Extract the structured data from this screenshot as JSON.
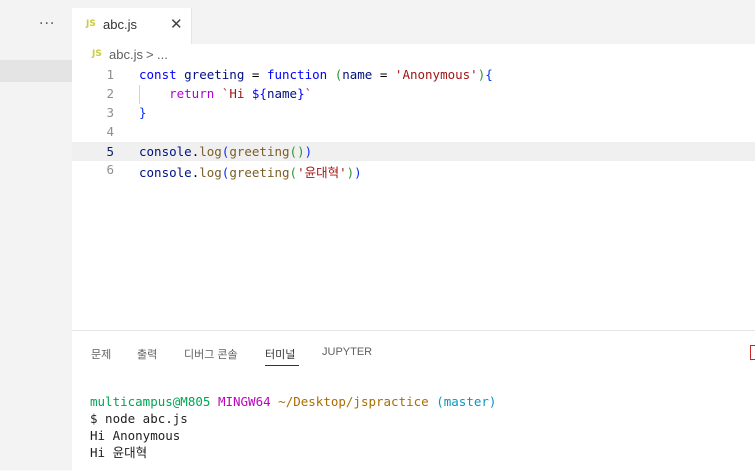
{
  "tab_bar": {
    "more_label": "···",
    "active_tab": {
      "icon": "JS",
      "title": "abc.js",
      "close": "✕"
    }
  },
  "breadcrumb": {
    "icon": "JS",
    "file": "abc.js",
    "separator": ">",
    "more": "..."
  },
  "editor": {
    "current_line": 5,
    "lines": [
      {
        "num": "1",
        "tokens": [
          {
            "t": "const ",
            "c": "kw"
          },
          {
            "t": "greeting",
            "c": "var"
          },
          {
            "t": " = ",
            "c": "plain"
          },
          {
            "t": "function",
            "c": "kw"
          },
          {
            "t": " ",
            "c": "plain"
          },
          {
            "t": "(",
            "c": "br2"
          },
          {
            "t": "name",
            "c": "var"
          },
          {
            "t": " = ",
            "c": "plain"
          },
          {
            "t": "'Anonymous'",
            "c": "str"
          },
          {
            "t": ")",
            "c": "br2"
          },
          {
            "t": "{",
            "c": "br1"
          }
        ]
      },
      {
        "num": "2",
        "tokens": [
          {
            "t": "    return ",
            "c": "kw2"
          },
          {
            "t": "`Hi ",
            "c": "str"
          },
          {
            "t": "${",
            "c": "kw"
          },
          {
            "t": "name",
            "c": "var"
          },
          {
            "t": "}",
            "c": "kw"
          },
          {
            "t": "`",
            "c": "str"
          }
        ]
      },
      {
        "num": "3",
        "tokens": [
          {
            "t": "}",
            "c": "br1"
          }
        ]
      },
      {
        "num": "4",
        "tokens": []
      },
      {
        "num": "5",
        "tokens": [
          {
            "t": "console",
            "c": "var"
          },
          {
            "t": ".",
            "c": "plain"
          },
          {
            "t": "log",
            "c": "fn"
          },
          {
            "t": "(",
            "c": "br1"
          },
          {
            "t": "greeting",
            "c": "fn"
          },
          {
            "t": "()",
            "c": "br2"
          },
          {
            "t": ")",
            "c": "br1"
          }
        ]
      },
      {
        "num": "6",
        "tokens": [
          {
            "t": "console",
            "c": "var"
          },
          {
            "t": ".",
            "c": "plain"
          },
          {
            "t": "log",
            "c": "fn"
          },
          {
            "t": "(",
            "c": "br1"
          },
          {
            "t": "greeting",
            "c": "fn"
          },
          {
            "t": "(",
            "c": "br2"
          },
          {
            "t": "'윤대혁'",
            "c": "str"
          },
          {
            "t": ")",
            "c": "br2"
          },
          {
            "t": ")",
            "c": "br1"
          }
        ]
      }
    ]
  },
  "panel": {
    "tabs": [
      "문제",
      "출력",
      "디버그 콘솔",
      "터미널",
      "JUPYTER"
    ],
    "active_tab": "터미널",
    "terminal": {
      "prompt_user": "multicampus@M805",
      "prompt_system": "MINGW64",
      "prompt_path": "~/Desktop/jspractice",
      "prompt_branch": "(master)",
      "command": "$ node abc.js",
      "output": [
        "Hi Anonymous",
        "Hi 윤대혁"
      ]
    }
  }
}
